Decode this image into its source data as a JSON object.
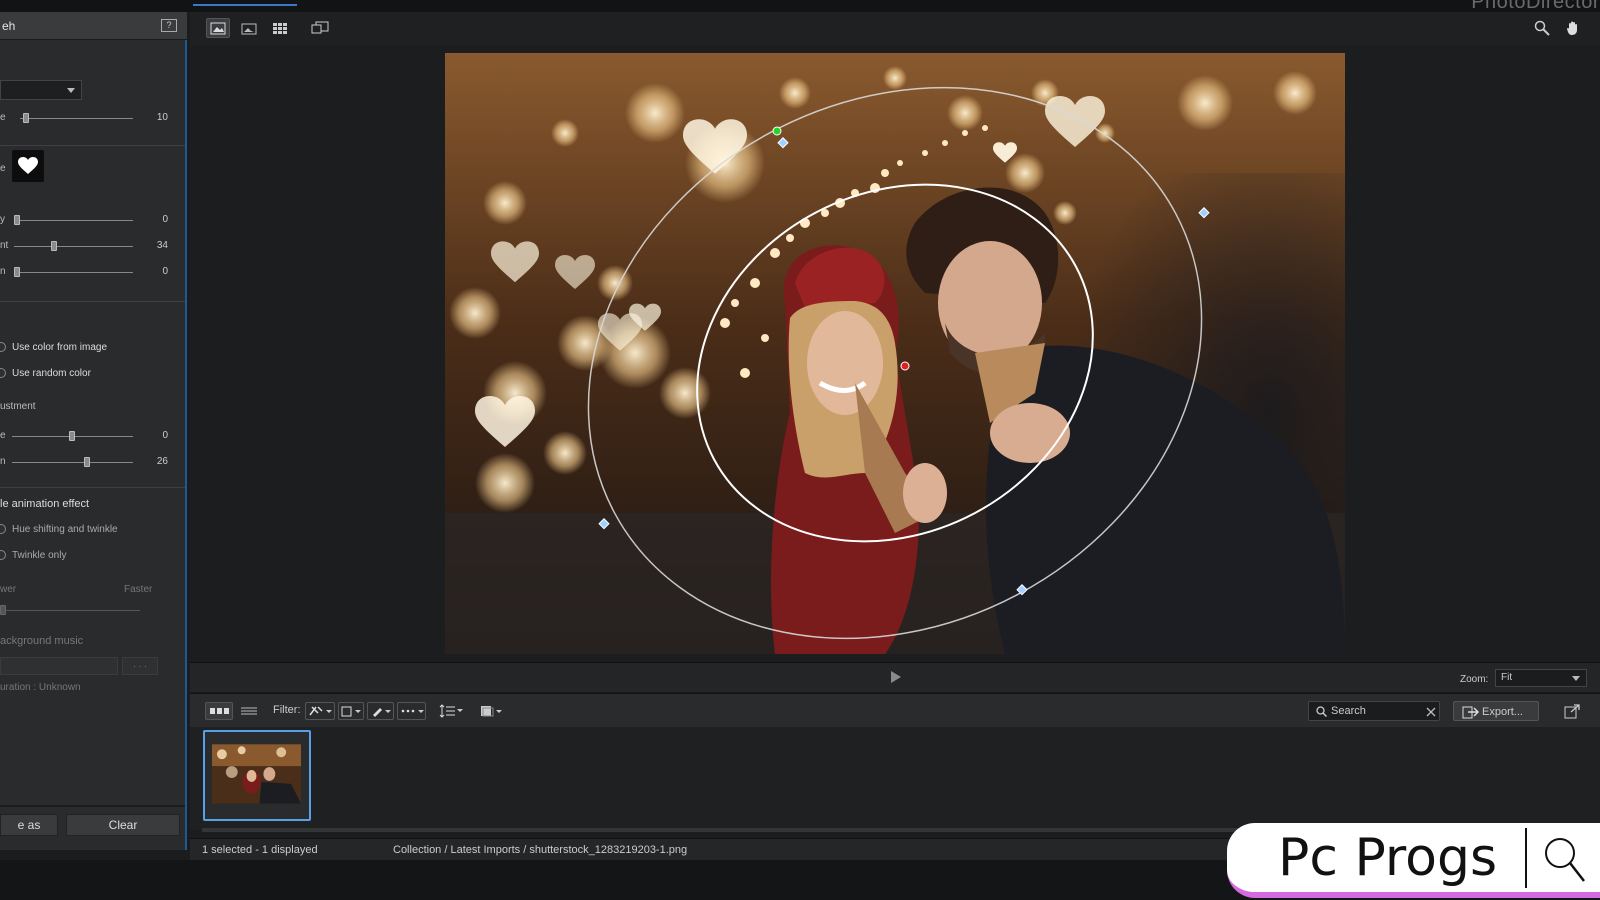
{
  "app": {
    "brand": "PhotoDirector"
  },
  "left_panel": {
    "title": "eh",
    "popout_icon": "popout-icon",
    "size_label": "e",
    "size_value": "10",
    "shape_label": "e",
    "density_label": "y",
    "density_value": "0",
    "amount_label": "nt",
    "amount_value": "34",
    "rotation_label": "n",
    "rotation_value": "0",
    "color_options": [
      "Use color from image",
      "Use random color"
    ],
    "adjustment_label": "ustment",
    "hue_label": "e",
    "hue_value": "0",
    "saturation_label": "n",
    "saturation_value": "26",
    "animation_label": "le animation effect",
    "animation_options": [
      "Hue shifting and twinkle",
      "Twinkle only"
    ],
    "speed_slow": "wer",
    "speed_fast": "Faster",
    "music_label": "ackground music",
    "music_browse": "· · ·",
    "duration_label": "uration : Unknown",
    "save_as_label": "e as",
    "clear_label": "Clear"
  },
  "viewer": {
    "zoom_label": "Zoom:",
    "zoom_value": "Fit"
  },
  "filter_bar": {
    "filter_label": "Filter:",
    "search_placeholder": "Search",
    "export_label": "Export..."
  },
  "status": {
    "selection": "1 selected - 1 displayed",
    "path": "Collection / Latest Imports / shutterstock_1283219203-1.png"
  },
  "watermark": {
    "text": "Pc Progs"
  }
}
